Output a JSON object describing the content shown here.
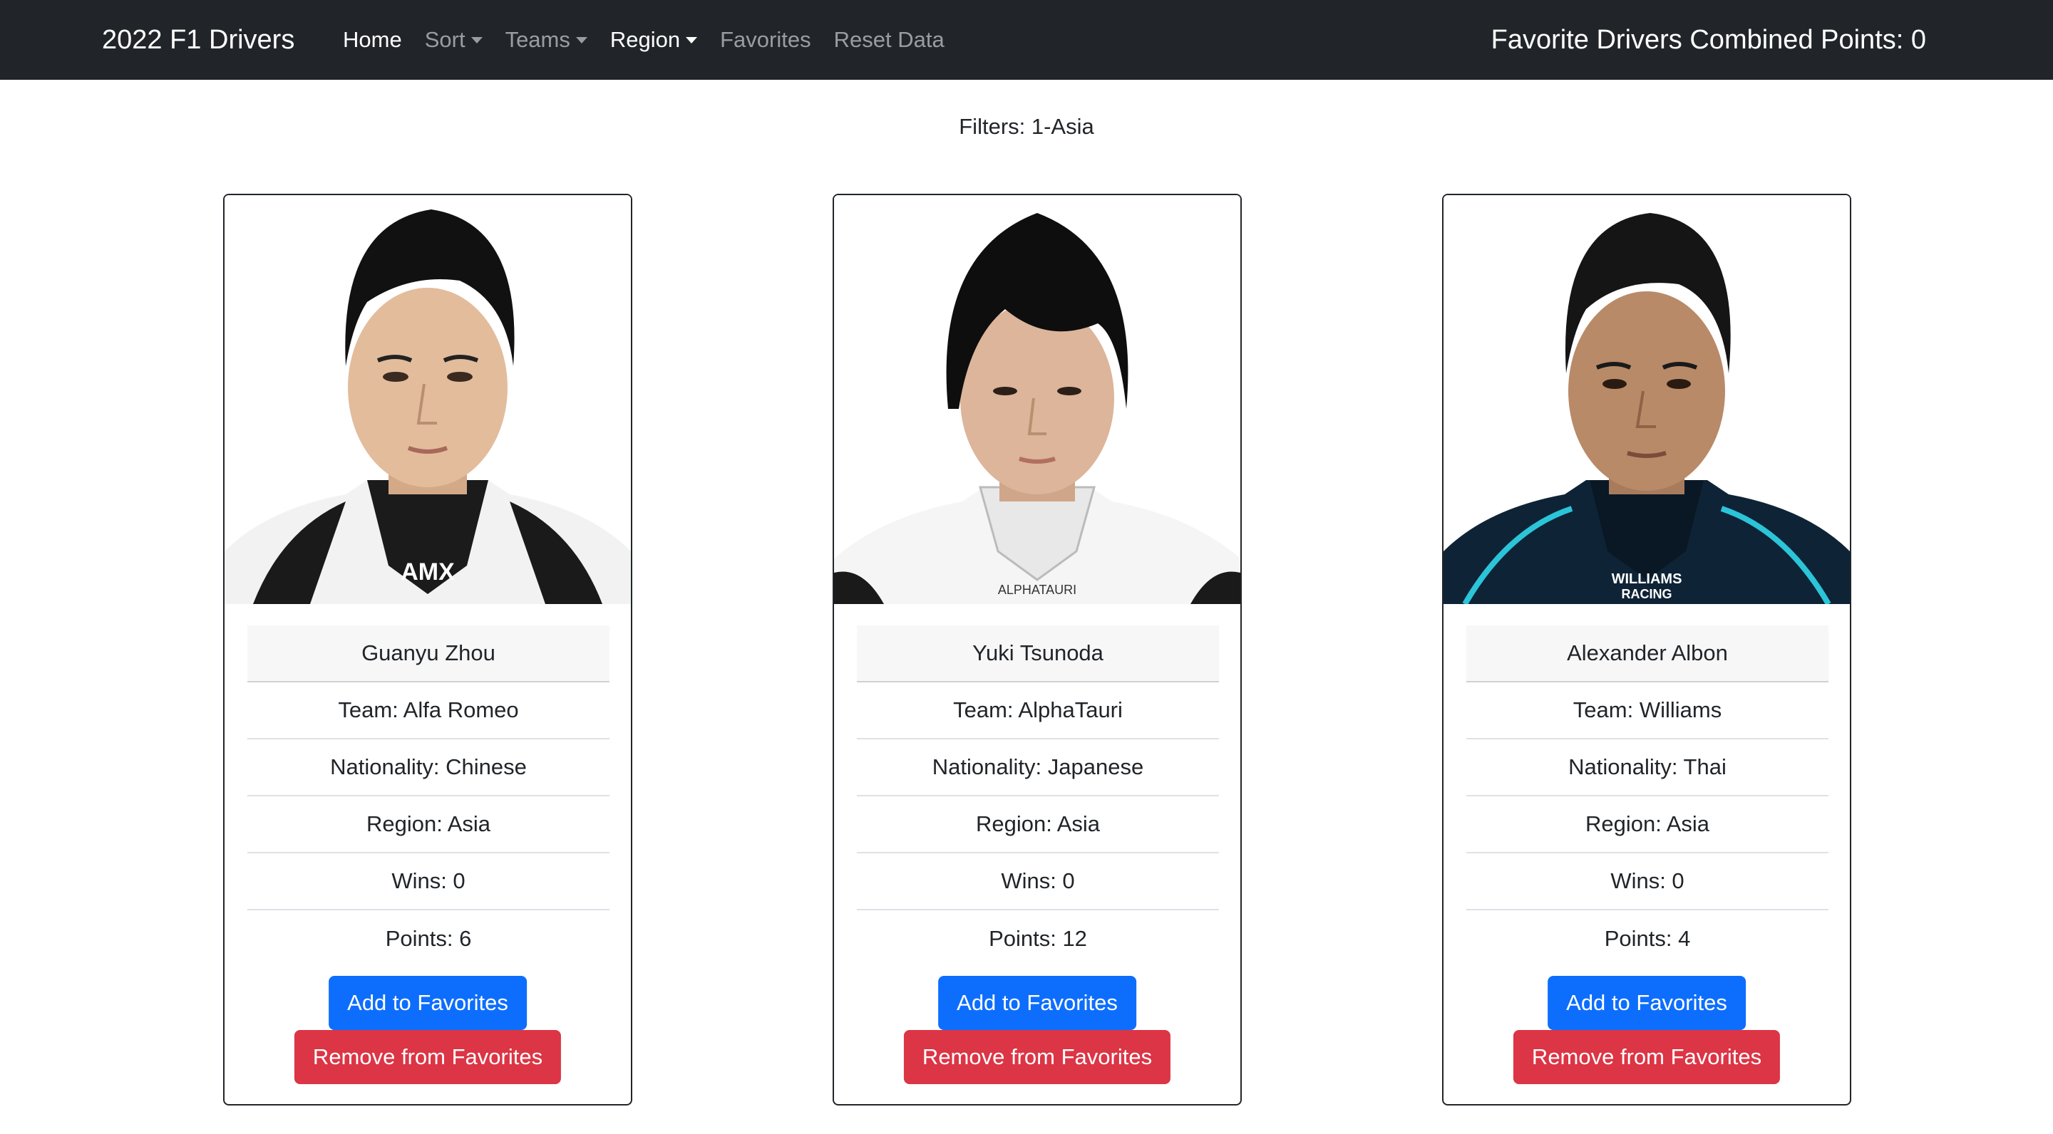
{
  "navbar": {
    "brand": "2022 F1 Drivers",
    "links": {
      "home": "Home",
      "sort": "Sort",
      "teams": "Teams",
      "region": "Region",
      "favorites": "Favorites",
      "reset": "Reset Data"
    },
    "favorite_points_label": "Favorite Drivers Combined Points: 0"
  },
  "filters_text": "Filters: 1-Asia",
  "drivers": [
    {
      "name": "Guanyu Zhou",
      "team": "Team: Alfa Romeo",
      "nationality": "Nationality: Chinese",
      "region": "Region: Asia",
      "wins": "Wins: 0",
      "points": "Points: 6",
      "add_label": "Add to Favorites",
      "remove_label": "Remove from Favorites",
      "suit_text": "AMX",
      "colors": {
        "hair": "#111111",
        "skin": "#e3bc9c",
        "suit": "#f2f2f2",
        "collar": "#1b1b1b"
      }
    },
    {
      "name": "Yuki Tsunoda",
      "team": "Team: AlphaTauri",
      "nationality": "Nationality: Japanese",
      "region": "Region: Asia",
      "wins": "Wins: 0",
      "points": "Points: 12",
      "add_label": "Add to Favorites",
      "remove_label": "Remove from Favorites",
      "suit_text": "ALPHATAURI",
      "colors": {
        "hair": "#0e0e0e",
        "skin": "#dcb59a",
        "suit": "#f5f5f5",
        "collar": "#e8e8e8"
      }
    },
    {
      "name": "Alexander Albon",
      "team": "Team: Williams",
      "nationality": "Nationality: Thai",
      "region": "Region: Asia",
      "wins": "Wins: 0",
      "points": "Points: 4",
      "add_label": "Add to Favorites",
      "remove_label": "Remove from Favorites",
      "suit_text": "WILLIAMS RACING",
      "colors": {
        "hair": "#151515",
        "skin": "#b98a68",
        "suit": "#0f2336",
        "collar": "#0a1826"
      }
    }
  ]
}
